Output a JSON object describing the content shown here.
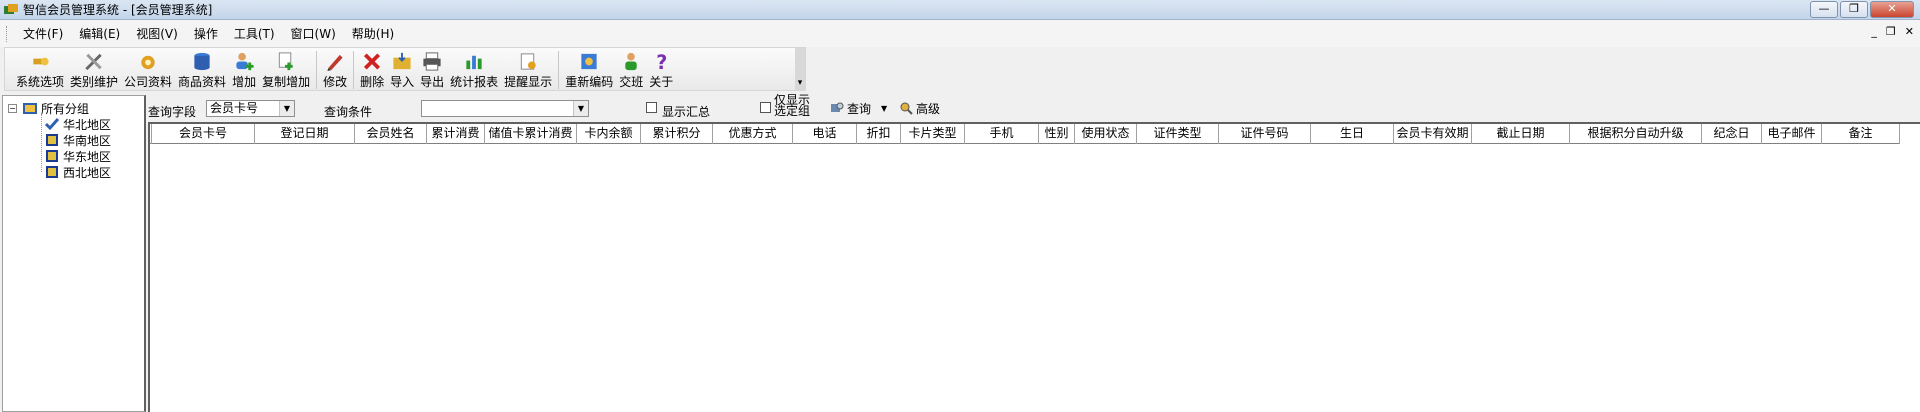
{
  "window": {
    "title": "智信会员管理系统 - [会员管理系统]"
  },
  "menu": [
    "文件(F)",
    "编辑(E)",
    "视图(V)",
    "操作",
    "工具(T)",
    "窗口(W)",
    "帮助(H)"
  ],
  "toolbar": {
    "items": [
      {
        "label": "系统选项",
        "icon": "wrench-key-icon"
      },
      {
        "label": "类别维护",
        "icon": "tools-icon"
      },
      {
        "label": "公司资料",
        "icon": "gear-house-icon"
      },
      {
        "label": "商品资料",
        "icon": "database-icon"
      },
      {
        "label": "增加",
        "icon": "add-user-icon"
      },
      {
        "label": "复制增加",
        "icon": "copy-add-icon"
      },
      {
        "label": "修改",
        "icon": "pencil-icon"
      },
      {
        "label": "删除",
        "icon": "delete-x-icon"
      },
      {
        "label": "导入",
        "icon": "folder-import-icon"
      },
      {
        "label": "导出",
        "icon": "printer-export-icon"
      },
      {
        "label": "统计报表",
        "icon": "bar-chart-icon"
      },
      {
        "label": "提醒显示",
        "icon": "reminder-icon"
      },
      {
        "label": "重新编码",
        "icon": "recode-icon"
      },
      {
        "label": "交班",
        "icon": "handover-user-icon"
      },
      {
        "label": "关于",
        "icon": "question-icon"
      }
    ]
  },
  "tree": {
    "root": "所有分组",
    "children": [
      "华北地区",
      "华南地区",
      "华东地区",
      "西北地区"
    ]
  },
  "query": {
    "field_label": "查询字段",
    "field_value": "会员卡号",
    "condition_label": "查询条件",
    "condition_value": "",
    "show_summary": "显示汇总",
    "only_selected_line1": "仅显示",
    "only_selected_line2": "选定组",
    "search_button": "查询",
    "advanced_button": "高级"
  },
  "grid": {
    "columns": [
      "会员卡号",
      "登记日期",
      "会员姓名",
      "累计消费",
      "储值卡累计消费",
      "卡内余额",
      "累计积分",
      "优惠方式",
      "电话",
      "折扣",
      "卡片类型",
      "手机",
      "性别",
      "使用状态",
      "证件类型",
      "证件号码",
      "生日",
      "会员卡有效期",
      "截止日期",
      "根据积分自动升级",
      "纪念日",
      "电子邮件",
      "备注"
    ],
    "rows": []
  },
  "colors": {
    "titlebar": "#c4d5ea",
    "background": "#f0f0f0"
  }
}
